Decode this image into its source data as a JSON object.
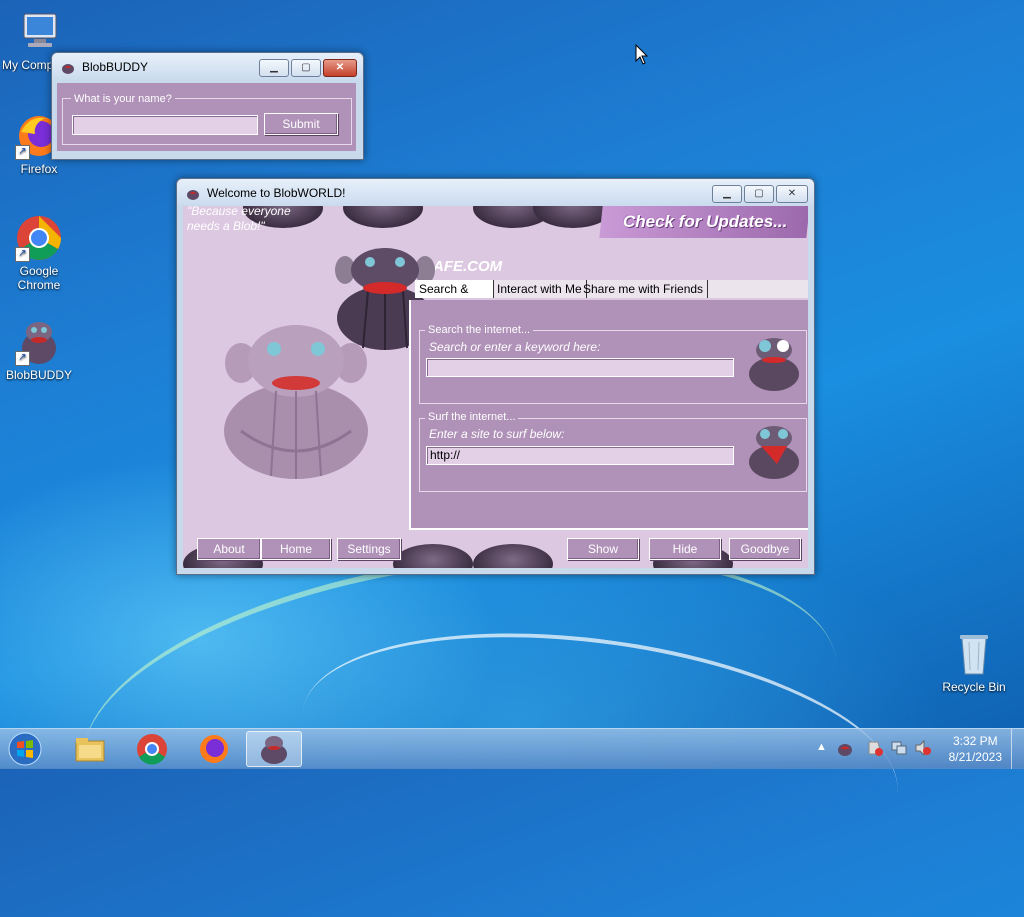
{
  "desktop": {
    "icons": [
      {
        "label": "My Computer"
      },
      {
        "label": "Firefox"
      },
      {
        "label": "Google Chrome"
      },
      {
        "label": "BlobBUDDY"
      },
      {
        "label": "Recycle Bin"
      }
    ]
  },
  "buddy_window": {
    "title": "BlobBUDDY",
    "group_label": "What is your name?",
    "name_value": "",
    "submit_label": "Submit"
  },
  "world_window": {
    "title": "Welcome to BlobWORLD!",
    "tagline": "\"Because everyone needs a Blob!\"",
    "updates_label": "Check for Updates...",
    "partial_banner": "AFE.COM",
    "tabs": [
      "Search & Surf",
      "Interact with Me",
      "Share me with Friends"
    ],
    "search": {
      "group_label": "Search the internet...",
      "prompt": "Search or enter a keyword here:",
      "value": ""
    },
    "surf": {
      "group_label": "Surf the internet...",
      "prompt": "Enter a site to surf below:",
      "value": "http://"
    },
    "buttons": {
      "about": "About",
      "home": "Home",
      "settings": "Settings",
      "show": "Show",
      "hide": "Hide",
      "goodbye": "Goodbye"
    }
  },
  "taskbar": {
    "time": "3:32 PM",
    "date": "8/21/2023",
    "apps": [
      "start",
      "file-explorer",
      "chrome",
      "firefox",
      "blobbuddy"
    ]
  },
  "colors": {
    "window_lilac": "#b091b8",
    "desktop_blue": "#1d7fd4"
  }
}
